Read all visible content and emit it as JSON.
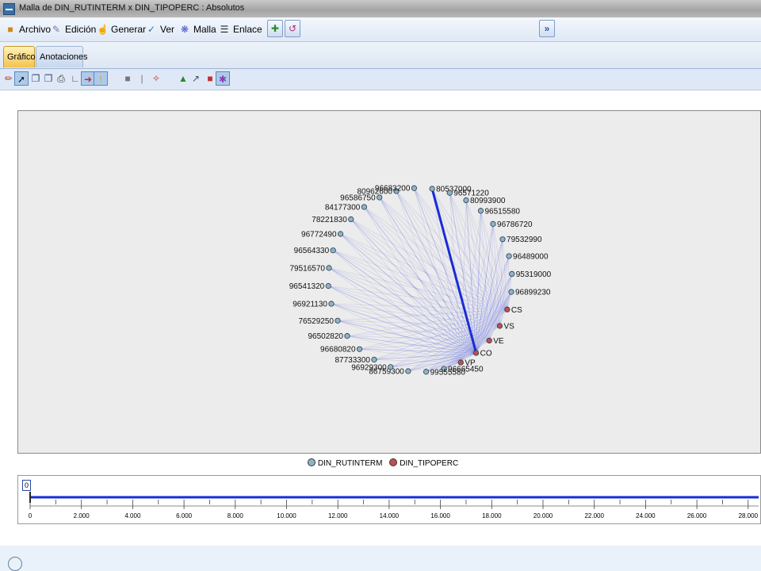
{
  "window": {
    "title": "Malla de DIN_RUTINTERM x DIN_TIPOPERC : Absolutos"
  },
  "menu": {
    "items": [
      {
        "label": "Archivo",
        "icon": "folder-icon"
      },
      {
        "label": "Edición",
        "icon": "edit-icon"
      },
      {
        "label": "Generar",
        "icon": "generate-icon"
      },
      {
        "label": "Ver",
        "icon": "view-icon"
      },
      {
        "label": "Malla",
        "icon": "web-icon"
      },
      {
        "label": "Enlace",
        "icon": "link-icon"
      }
    ],
    "toolbar_buttons": [
      "add-node-icon",
      "export-icon"
    ],
    "overflow_label": "»"
  },
  "tabs": [
    {
      "label": "Gráfico",
      "active": true
    },
    {
      "label": "Anotaciones",
      "active": false
    }
  ],
  "graph": {
    "nodes": [
      {
        "label": "80537000",
        "type": "DIN_RUTINTERM"
      },
      {
        "label": "96571220",
        "type": "DIN_RUTINTERM"
      },
      {
        "label": "80993900",
        "type": "DIN_RUTINTERM"
      },
      {
        "label": "96515580",
        "type": "DIN_RUTINTERM"
      },
      {
        "label": "96786720",
        "type": "DIN_RUTINTERM"
      },
      {
        "label": "79532990",
        "type": "DIN_RUTINTERM"
      },
      {
        "label": "96489000",
        "type": "DIN_RUTINTERM"
      },
      {
        "label": "95319000",
        "type": "DIN_RUTINTERM"
      },
      {
        "label": "96899230",
        "type": "DIN_RUTINTERM"
      },
      {
        "label": "CS",
        "type": "DIN_TIPOPERC"
      },
      {
        "label": "VS",
        "type": "DIN_TIPOPERC"
      },
      {
        "label": "VE",
        "type": "DIN_TIPOPERC"
      },
      {
        "label": "CO",
        "type": "DIN_TIPOPERC"
      },
      {
        "label": "VP",
        "type": "DIN_TIPOPERC"
      },
      {
        "label": "96665450",
        "type": "DIN_RUTINTERM"
      },
      {
        "label": "99555580",
        "type": "DIN_RUTINTERM"
      },
      {
        "label": "86759300",
        "type": "DIN_RUTINTERM"
      },
      {
        "label": "96929300",
        "type": "DIN_RUTINTERM"
      },
      {
        "label": "87733300",
        "type": "DIN_RUTINTERM"
      },
      {
        "label": "96680820",
        "type": "DIN_RUTINTERM"
      },
      {
        "label": "96502820",
        "type": "DIN_RUTINTERM"
      },
      {
        "label": "76529250",
        "type": "DIN_RUTINTERM"
      },
      {
        "label": "96921130",
        "type": "DIN_RUTINTERM"
      },
      {
        "label": "96541320",
        "type": "DIN_RUTINTERM"
      },
      {
        "label": "79516570",
        "type": "DIN_RUTINTERM"
      },
      {
        "label": "96564330",
        "type": "DIN_RUTINTERM"
      },
      {
        "label": "96772490",
        "type": "DIN_RUTINTERM"
      },
      {
        "label": "78221830",
        "type": "DIN_RUTINTERM"
      },
      {
        "label": "84177300",
        "type": "DIN_RUTINTERM"
      },
      {
        "label": "96586750",
        "type": "DIN_RUTINTERM"
      },
      {
        "label": "80962600",
        "type": "DIN_RUTINTERM"
      },
      {
        "label": "96683200",
        "type": "DIN_RUTINTERM"
      }
    ],
    "strong_link": [
      "80537000",
      "CO"
    ],
    "colors": {
      "rutinterm": "#8fb3c9",
      "tipoperc": "#c0504d",
      "link": "#1a2bd8",
      "faint_link": "#b8bdf0"
    }
  },
  "legend": {
    "items": [
      {
        "label": "DIN_RUTINTERM",
        "color": "#8fb3c9"
      },
      {
        "label": "DIN_TIPOPERC",
        "color": "#c0504d"
      }
    ]
  },
  "slider": {
    "value_label": "0",
    "ticks": [
      "0",
      "2.000",
      "4.000",
      "6.000",
      "8.000",
      "10.000",
      "12.000",
      "14.000",
      "16.000",
      "18.000",
      "20.000",
      "22.000",
      "24.000",
      "26.000",
      "28.000"
    ]
  }
}
